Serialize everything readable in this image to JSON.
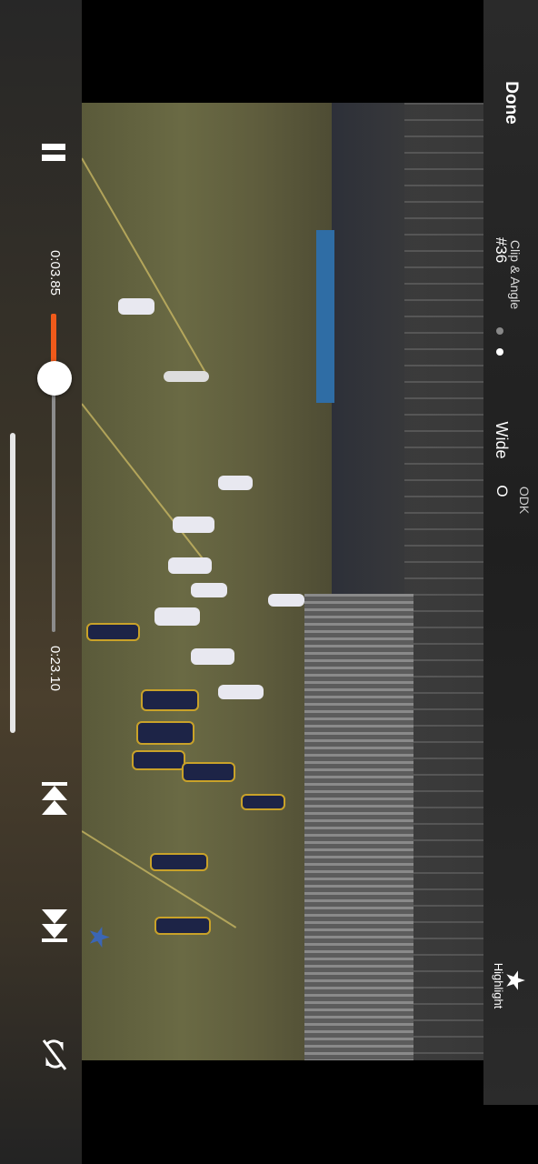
{
  "header": {
    "done_label": "Done",
    "clip_title": "Clip & Angle",
    "clip_number": "#36",
    "odk_label": "ODK",
    "odk_value": "O",
    "angle_label": "Wide",
    "page_dots": 2,
    "active_dot": 1
  },
  "playback": {
    "current_time": "0:03.85",
    "duration": "0:23.10",
    "progress": 0.166,
    "state": "playing"
  },
  "controls": {
    "pause_icon": "pause-icon",
    "prev_icon": "skip-previous-icon",
    "next_icon": "skip-next-icon",
    "loop_icon": "loop-off-icon"
  },
  "actions": {
    "highlight_label": "Highlight",
    "highlight_icon": "star-icon"
  },
  "colors": {
    "accent": "#f05a1a",
    "thumb": "#ffffff",
    "track": "#8c8c8c"
  }
}
